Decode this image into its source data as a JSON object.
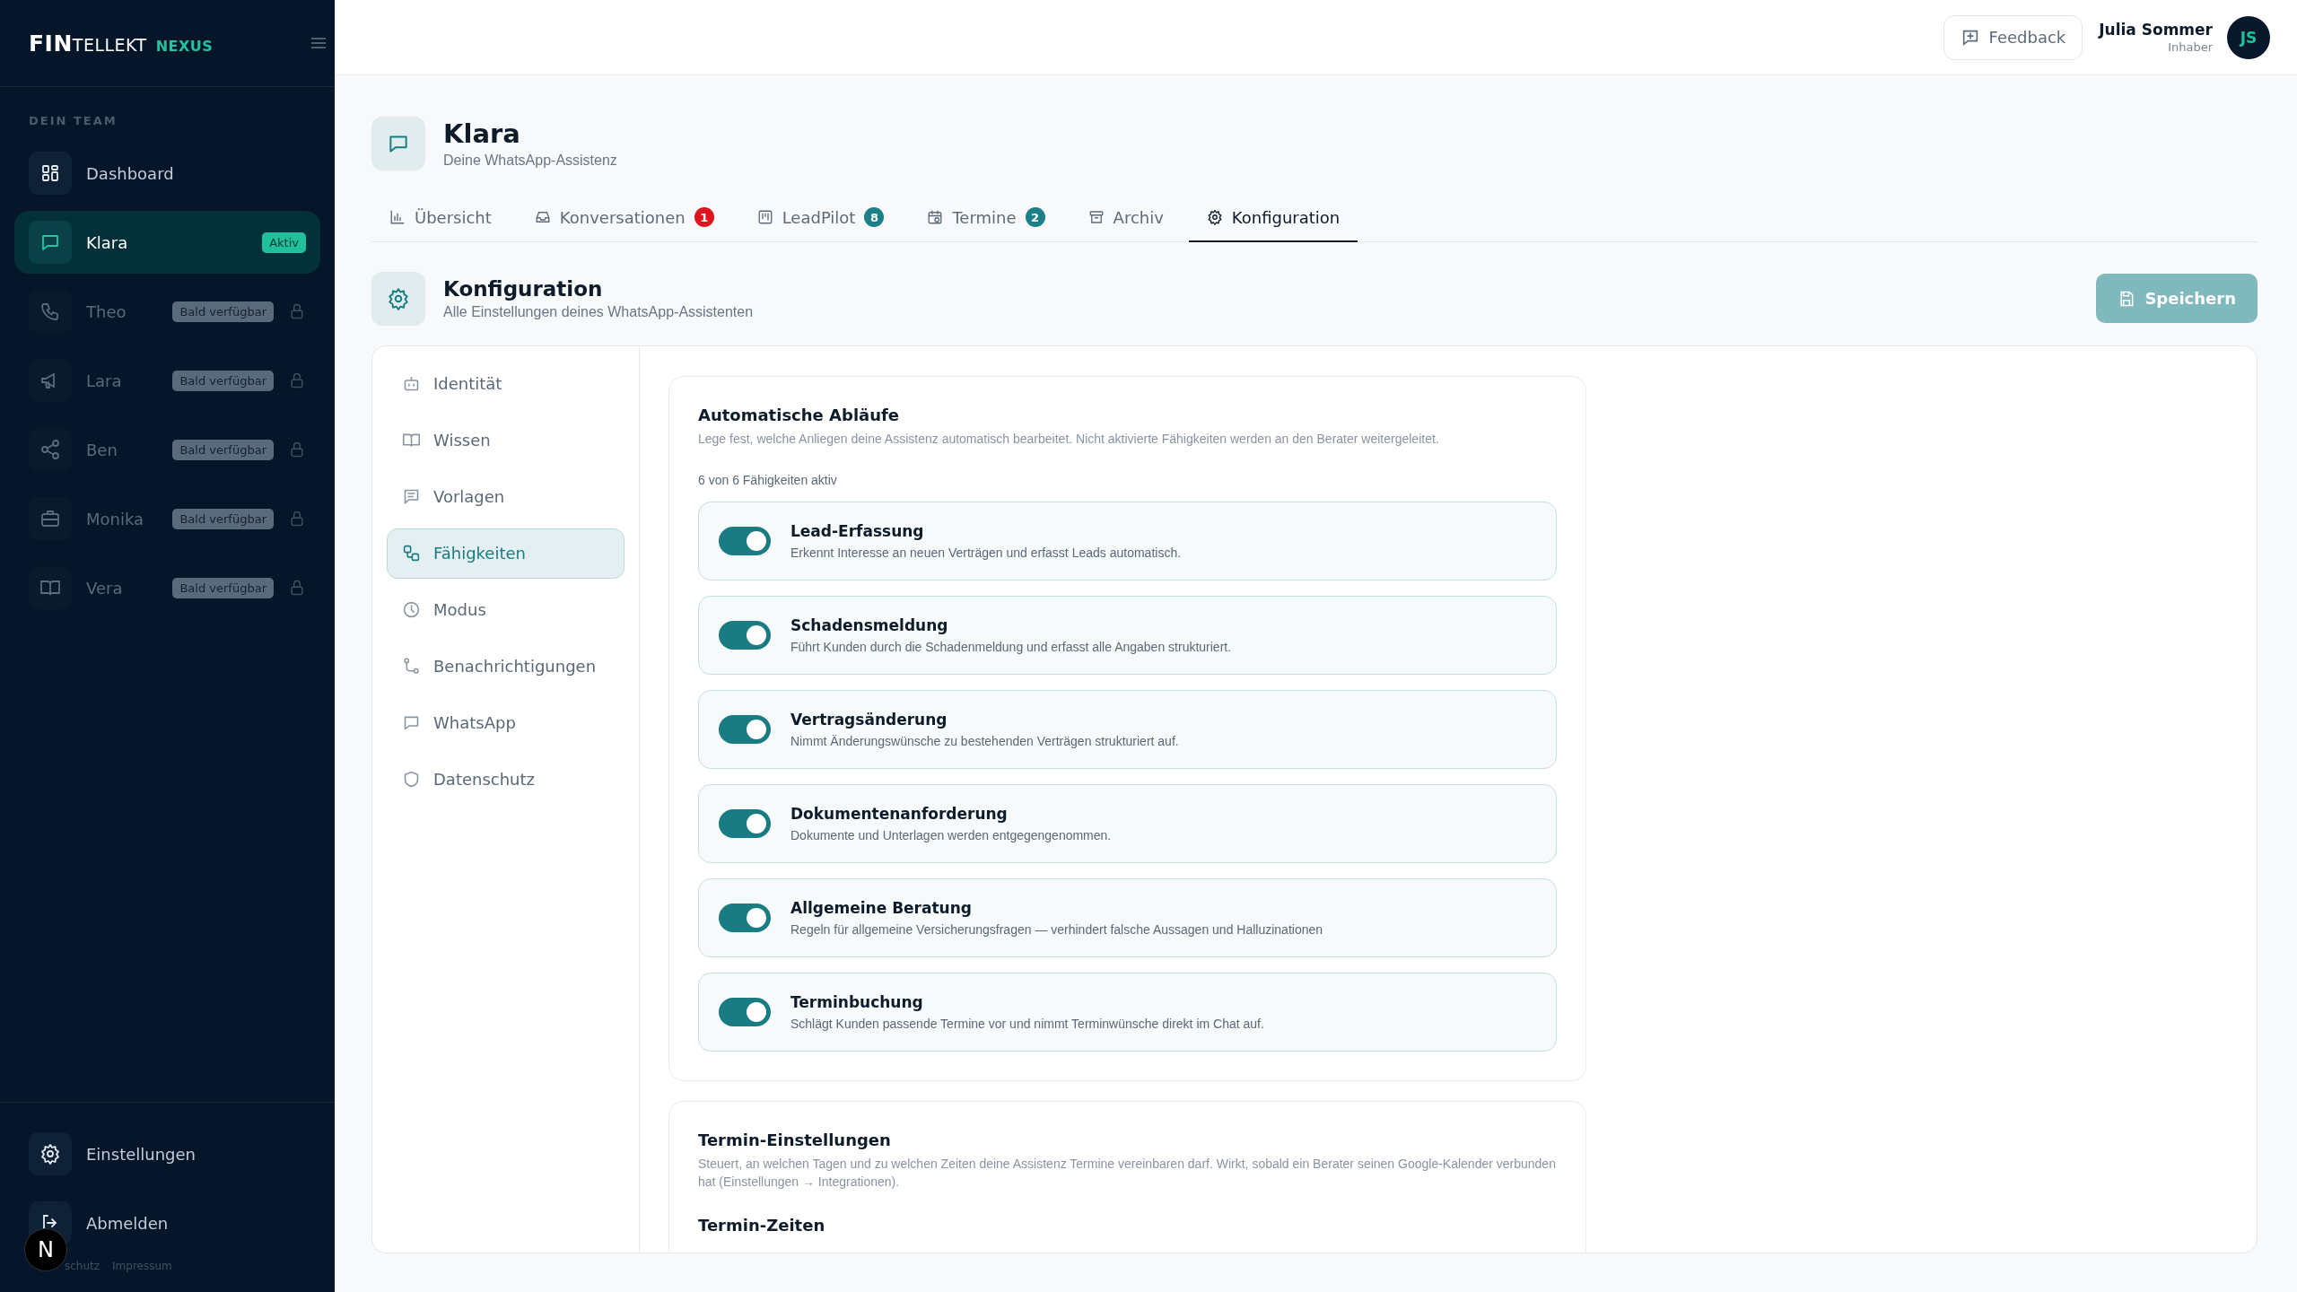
{
  "sidebar": {
    "logo": {
      "strong": "FIN",
      "light": "TELLEKT",
      "tag": "NEXUS"
    },
    "section_label": "DEIN TEAM",
    "items": [
      {
        "label": "Dashboard",
        "kind": "grid",
        "selected": false,
        "disabled": false
      },
      {
        "label": "Klara",
        "kind": "chat",
        "selected": true,
        "disabled": false,
        "badge": "Aktiv"
      },
      {
        "label": "Theo",
        "kind": "phone",
        "selected": false,
        "disabled": true,
        "badge": "Bald verfügbar"
      },
      {
        "label": "Lara",
        "kind": "megaphone",
        "selected": false,
        "disabled": true,
        "badge": "Bald verfügbar"
      },
      {
        "label": "Ben",
        "kind": "share",
        "selected": false,
        "disabled": true,
        "badge": "Bald verfügbar"
      },
      {
        "label": "Monika",
        "kind": "briefcase",
        "selected": false,
        "disabled": true,
        "badge": "Bald verfügbar"
      },
      {
        "label": "Vera",
        "kind": "book",
        "selected": false,
        "disabled": true,
        "badge": "Bald verfügbar"
      }
    ],
    "bottom_items": [
      {
        "label": "Einstellungen",
        "kind": "gear"
      },
      {
        "label": "Abmelden",
        "kind": "logout"
      }
    ],
    "footer_links": [
      "schutz",
      "Impressum"
    ],
    "dev_badge": "N"
  },
  "header": {
    "feedback_button": "Feedback",
    "user": {
      "name": "Julia Sommer",
      "role": "Inhaber",
      "initials": "JS"
    }
  },
  "agent": {
    "title": "Klara",
    "subtitle": "Deine WhatsApp-Assistenz"
  },
  "tabs": [
    {
      "label": "Übersicht",
      "kind": "chart",
      "selected": false
    },
    {
      "label": "Konversationen",
      "kind": "inbox",
      "selected": false,
      "count": "1",
      "color": "#e0141e"
    },
    {
      "label": "LeadPilot",
      "kind": "kanban",
      "selected": false,
      "count": "8",
      "color": "#1a7f86"
    },
    {
      "label": "Termine",
      "kind": "calendar",
      "selected": false,
      "count": "2",
      "color": "#1a7f86"
    },
    {
      "label": "Archiv",
      "kind": "archive",
      "selected": false
    },
    {
      "label": "Konfiguration",
      "kind": "gear",
      "selected": true
    }
  ],
  "section": {
    "title": "Konfiguration",
    "subtitle": "Alle Einstellungen deines WhatsApp-Assistenten",
    "save_button": {
      "label": "Speichern",
      "disabled": true
    }
  },
  "config_nav": [
    {
      "label": "Identität",
      "kind": "bot",
      "selected": false
    },
    {
      "label": "Wissen",
      "kind": "book",
      "selected": false
    },
    {
      "label": "Vorlagen",
      "kind": "note",
      "selected": false
    },
    {
      "label": "Fähigkeiten",
      "kind": "workflow",
      "selected": true
    },
    {
      "label": "Modus",
      "kind": "clock",
      "selected": false
    },
    {
      "label": "Benachrichtigungen",
      "kind": "route",
      "selected": false
    },
    {
      "label": "WhatsApp",
      "kind": "chat",
      "selected": false
    },
    {
      "label": "Datenschutz",
      "kind": "shield",
      "selected": false
    }
  ],
  "automation": {
    "title": "Automatische Abläufe",
    "description": "Lege fest, welche Anliegen deine Assistenz automatisch bearbeitet. Nicht aktivierte Fähigkeiten werden an den Berater weitergeleitet.",
    "count_text": "6 von 6 Fähigkeiten aktiv",
    "skills": [
      {
        "title": "Lead-Erfassung",
        "description": "Erkennt Interesse an neuen Verträgen und erfasst Leads automatisch.",
        "on": true
      },
      {
        "title": "Schadensmeldung",
        "description": "Führt Kunden durch die Schadenmeldung und erfasst alle Angaben strukturiert.",
        "on": true
      },
      {
        "title": "Vertragsänderung",
        "description": "Nimmt Änderungswünsche zu bestehenden Verträgen strukturiert auf.",
        "on": true
      },
      {
        "title": "Dokumentenanforderung",
        "description": "Dokumente und Unterlagen werden entgegengenommen.",
        "on": true
      },
      {
        "title": "Allgemeine Beratung",
        "description": "Regeln für allgemeine Versicherungsfragen — verhindert falsche Aussagen und Halluzinationen",
        "on": true
      },
      {
        "title": "Terminbuchung",
        "description": "Schlägt Kunden passende Termine vor und nimmt Terminwünsche direkt im Chat auf.",
        "on": true
      }
    ]
  },
  "appointments": {
    "title": "Termin-Einstellungen",
    "description": "Steuert, an welchen Tagen und zu welchen Zeiten deine Assistenz Termine vereinbaren darf. Wirkt, sobald ein Berater seinen Google-Kalender verbunden hat (Einstellungen → Integrationen).",
    "subheading": "Termin-Zeiten"
  }
}
